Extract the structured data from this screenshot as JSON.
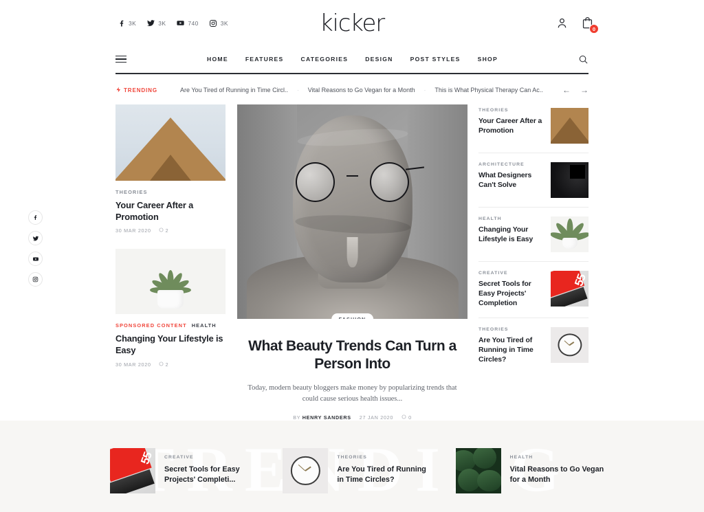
{
  "site": {
    "logo": "kicker"
  },
  "topbar": {
    "socials": [
      {
        "icon": "facebook-icon",
        "count": "3K"
      },
      {
        "icon": "twitter-icon",
        "count": "3K"
      },
      {
        "icon": "youtube-icon",
        "count": "740"
      },
      {
        "icon": "instagram-icon",
        "count": "3K"
      }
    ],
    "account_icon": "user-icon",
    "cart_icon": "cart-icon",
    "cart_count": "0"
  },
  "nav": {
    "menu_icon": "hamburger-icon",
    "search_icon": "search-icon",
    "links": [
      {
        "label": "HOME"
      },
      {
        "label": "FEATURES"
      },
      {
        "label": "CATEGORIES"
      },
      {
        "label": "DESIGN"
      },
      {
        "label": "POST STYLES"
      },
      {
        "label": "SHOP"
      }
    ]
  },
  "trending": {
    "label": "TRENDING",
    "bolt_icon": "bolt-icon",
    "items": [
      {
        "title": "Are You Tired of Running in Time Circl.."
      },
      {
        "title": "Vital Reasons to Go Vegan for a Month"
      },
      {
        "title": "This is What Physical Therapy Can Ac.."
      }
    ],
    "separator": "·",
    "prev_icon": "arrow-left-icon",
    "next_icon": "arrow-right-icon",
    "prev_glyph": "←",
    "next_glyph": "→"
  },
  "rail": {
    "socials": [
      {
        "icon": "facebook-icon"
      },
      {
        "icon": "twitter-icon"
      },
      {
        "icon": "youtube-icon"
      },
      {
        "icon": "instagram-icon"
      }
    ]
  },
  "left_column": {
    "cards": [
      {
        "image": "wooden-roof-peak",
        "category": "THEORIES",
        "title": "Your Career After a Promotion",
        "date": "30 MAR 2020",
        "comments": "2"
      },
      {
        "image": "plant-in-mug",
        "sponsored_label": "SPONSORED CONTENT",
        "category": "HEALTH",
        "title": "Changing Your Lifestyle is Easy",
        "date": "30 MAR 2020",
        "comments": "2"
      }
    ]
  },
  "feature": {
    "image": "wrapped-head-portrait",
    "badge": "FASHION",
    "title": "What Beauty Trends Can Turn a Person Into",
    "excerpt": "Today, modern beauty bloggers make money by popularizing trends that could cause serious health issues...",
    "by_label": "BY",
    "author": "HENRY SANDERS",
    "date": "27 JAN 2020",
    "comments": "0"
  },
  "sidebar": {
    "items": [
      {
        "category": "THEORIES",
        "title": "Your Career After a Promotion",
        "image": "wooden-roof-peak"
      },
      {
        "category": "ARCHITECTURE",
        "title": "What Designers Can't Solve",
        "image": "dark-interior"
      },
      {
        "category": "HEALTH",
        "title": "Changing Your Lifestyle is Easy",
        "image": "plant-in-mug"
      },
      {
        "category": "CREATIVE",
        "title": "Secret Tools for Easy Projects' Completion",
        "image": "red-laptop"
      },
      {
        "category": "THEORIES",
        "title": "Are You Tired of Running in Time Circles?",
        "image": "wall-clock"
      }
    ]
  },
  "band": {
    "watermark": "TRENDING",
    "cards": [
      {
        "category": "CREATIVE",
        "title": "Secret Tools for Easy Projects' Completi...",
        "image": "red-laptop"
      },
      {
        "category": "THEORIES",
        "title": "Are You Tired of Running in Time Circles?",
        "image": "wall-clock"
      },
      {
        "category": "HEALTH",
        "title": "Vital Reasons to Go Vegan for a Month",
        "image": "green-leaves"
      }
    ]
  },
  "colors": {
    "accent_red": "#f0453a",
    "ink": "#1d2026",
    "muted": "#8a8f98",
    "band_bg": "#f7f6f4"
  }
}
